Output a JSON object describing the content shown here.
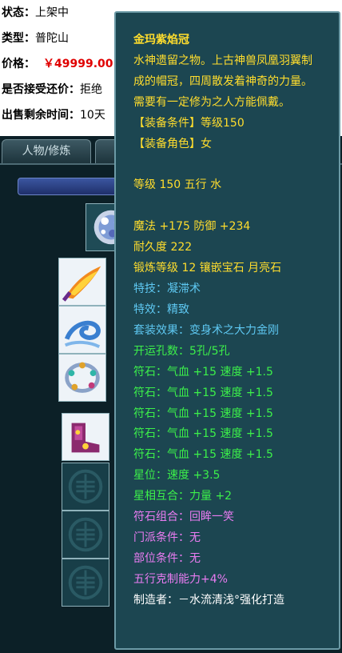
{
  "info": {
    "status_key": "状态：",
    "status_val": "上架中",
    "type_key": "类型：",
    "type_val": "普陀山",
    "price_key": "价格：",
    "price_val": "￥49999.00",
    "bargain_key": "是否接受还价：",
    "bargain_val": "拒绝",
    "time_key": "出售剩余时间：",
    "time_val": "10天"
  },
  "tabs": {
    "character": "人物/修炼"
  },
  "tooltip": {
    "title": "金玛紫焰冠",
    "description": "水神遗留之物。上古神兽凤凰羽翼制成的帽冠，四周散发着神奇的力量。需要有一定修为之人方能佩戴。",
    "req_level": "【装备条件】等级150",
    "req_role": "【装备角色】女",
    "level_element": "等级 150 五行 水",
    "stats": "魔法 +175 防御 +234",
    "durability": "耐久度 222",
    "forge": "锻炼等级 12 镶嵌宝石 月亮石",
    "skill": "特技：凝滞术",
    "effect": "特效：精致",
    "set_effect": "套装效果：变身术之大力金刚",
    "holes": "开运孔数：5孔/5孔",
    "runes": [
      "符石：气血 +15 速度 +1.5",
      "符石：气血 +15 速度 +1.5",
      "符石：气血 +15 速度 +1.5",
      "符石：气血 +15 速度 +1.5",
      "符石：气血 +15 速度 +1.5"
    ],
    "star": "星位：速度 +3.5",
    "star_match": "星相互合：力量 +2",
    "rune_combo": "符石组合：回眸一笑",
    "school_req": "门派条件：无",
    "part_req": "部位条件：无",
    "element_restrain": "五行克制能力+4%",
    "maker": "制造者：－水流清浅°强化打造"
  },
  "colors": {
    "tooltip_bg": "#1c4651",
    "title_yellow": "#ffdd2d",
    "skill_blue": "#5ec8f2",
    "rune_green": "#3cf04a",
    "combo_pink": "#ea7cf2",
    "price_red": "#e00000"
  },
  "icons": {
    "helmet": "jeweled-crown-icon",
    "weapon": "flame-feather-icon",
    "necklace": "water-swirl-icon",
    "belt": "gem-ring-icon",
    "boots": "jeweled-boots-icon",
    "empty": "empty-slot-icon"
  }
}
